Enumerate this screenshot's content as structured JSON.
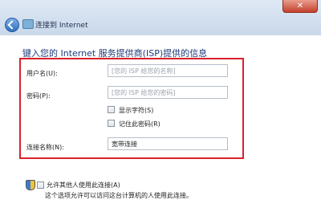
{
  "window": {
    "title": "连接到 Internet",
    "close_label": "✕"
  },
  "form": {
    "heading": "键入您的 Internet 服务提供商(ISP)提供的信息",
    "username": {
      "label": "用户名(U):",
      "placeholder": "[您的 ISP 给您的名称]"
    },
    "password": {
      "label": "密码(P):",
      "placeholder": "[您的 ISP 给您的密码]"
    },
    "show_chars": {
      "label": "显示字符(S)",
      "checked": false
    },
    "remember_password": {
      "label": "记住此密码(R)",
      "checked": false
    },
    "connection_name": {
      "label": "连接名称(N):",
      "value": "宽带连接"
    }
  },
  "allow_others": {
    "label": "允许其他人使用此连接(A)",
    "description": "这个选项允许可以访问这台计算机的人使用此连接。",
    "checked": false
  }
}
